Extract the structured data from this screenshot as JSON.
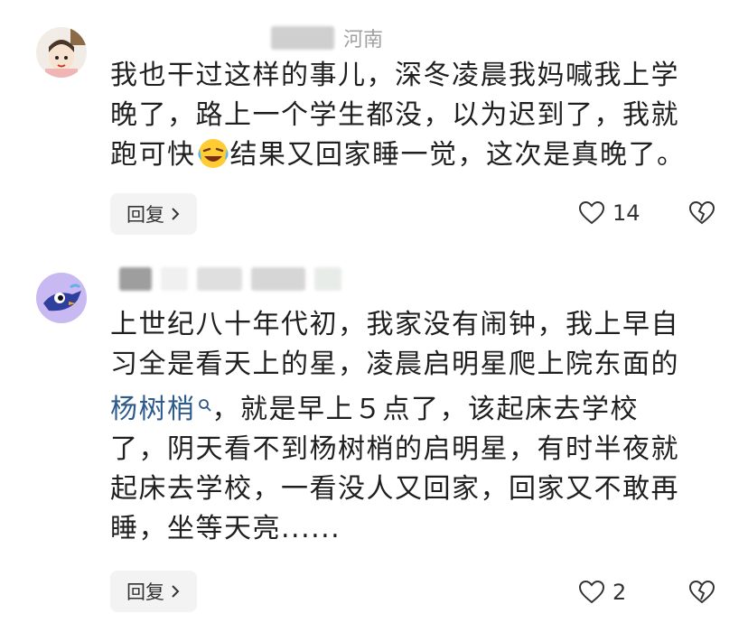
{
  "comments": [
    {
      "location": "河南",
      "lines": [
        "我也干过这样的事儿，深冬凌晨我妈喊我上学",
        "晚了，路上一个学生都没，以为迟到了，我就",
        "跑可快",
        "结果又回家睡一觉，这次是真晚了。"
      ],
      "emoji": "laughing-crying-emoji",
      "reply_label": "回复",
      "likes": "14"
    },
    {
      "lines": [
        "上世纪八十年代初，我家没有闹钟，我上早自",
        "习全是看天上的星，凌晨启明星爬上院东面的",
        "杨树梢",
        "，就是早上５点了，该起床去学校",
        "了，阴天看不到杨树梢的启明星，有时半夜就",
        "起床去学校，一看没人又回家，回家又不敢再",
        "睡，坐等天亮......"
      ],
      "reply_label": "回复",
      "likes": "2"
    }
  ],
  "icons": {
    "heart": "heart-icon",
    "broken_heart": "broken-heart-icon",
    "search": "search-icon",
    "chevron": "chevron-right-icon"
  },
  "colors": {
    "link": "#2f5b8c",
    "reply_bg": "#f3f3f3",
    "meta": "#9a9a9a"
  }
}
